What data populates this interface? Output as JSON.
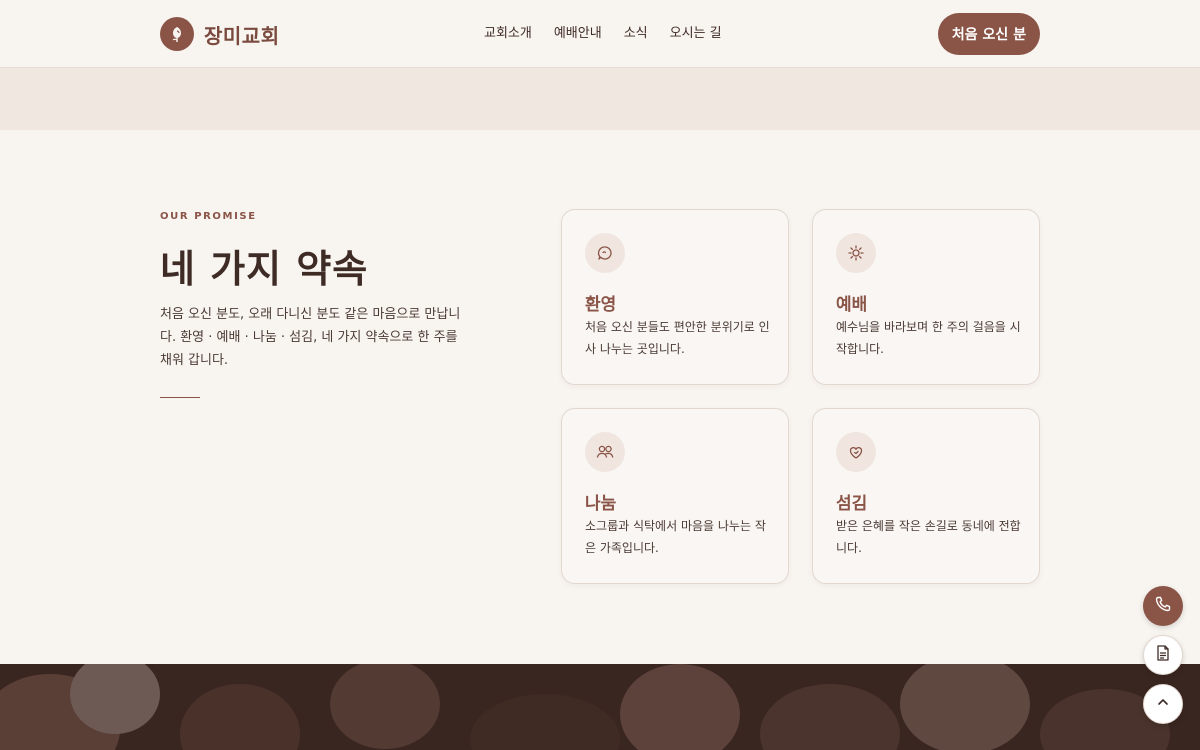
{
  "header": {
    "logo_text": "장미교회",
    "nav": [
      "교회소개",
      "예배안내",
      "소식",
      "오시는 길"
    ],
    "cta_label": "처음 오신 분"
  },
  "promise": {
    "eyebrow": "OUR PROMISE",
    "title": "네 가지 약속",
    "description": "처음 오신 분도, 오래 다니신 분도 같은 마음으로 만납니다. 환영 · 예배 · 나눔 · 섬김, 네 가지 약속으로 한 주를 채워 갑니다.",
    "cards": [
      {
        "icon": "chat-bubble-icon",
        "title": "환영",
        "text": "처음 오신 분들도 편안한 분위기로 인사 나누는 곳입니다."
      },
      {
        "icon": "sun-icon",
        "title": "예배",
        "text": "예수님을 바라보며 한 주의 걸음을 시작합니다."
      },
      {
        "icon": "people-icon",
        "title": "나눔",
        "text": "소그룹과 식탁에서 마음을 나누는 작은 가족입니다."
      },
      {
        "icon": "heart-hand-icon",
        "title": "섬김",
        "text": "받은 은혜를 작은 손길로 동네에 전합니다."
      }
    ]
  },
  "floating": {
    "call_icon": "phone-icon",
    "doc_icon": "document-icon",
    "top_icon": "chevron-up-icon"
  },
  "colors": {
    "accent": "#8a5447",
    "background": "#f8f4f0",
    "band": "#efe7e0",
    "text": "#3f2b26"
  }
}
